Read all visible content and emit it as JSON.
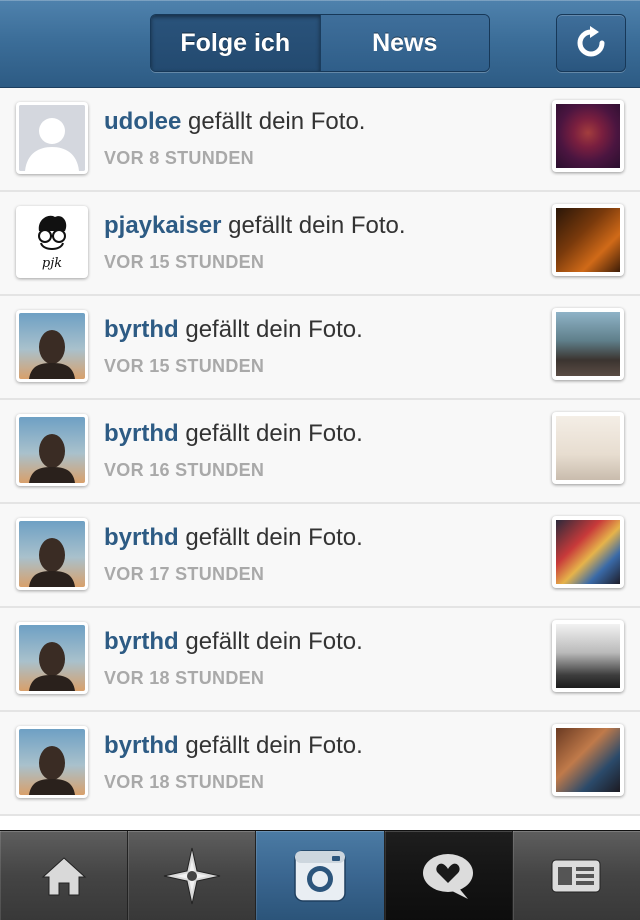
{
  "header": {
    "tabs": [
      {
        "label": "Folge ich",
        "active": true
      },
      {
        "label": "News",
        "active": false
      }
    ],
    "refresh_icon": "refresh-icon"
  },
  "news": [
    {
      "user": "udolee",
      "action": " gefällt dein Foto.",
      "time": "VOR 8 STUNDEN"
    },
    {
      "user": "pjaykaiser",
      "action": " gefällt dein Foto.",
      "time": "VOR 15 STUNDEN"
    },
    {
      "user": "byrthd",
      "action": " gefällt dein Foto.",
      "time": "VOR 15 STUNDEN"
    },
    {
      "user": "byrthd",
      "action": " gefällt dein Foto.",
      "time": "VOR 16 STUNDEN"
    },
    {
      "user": "byrthd",
      "action": " gefällt dein Foto.",
      "time": "VOR 17 STUNDEN"
    },
    {
      "user": "byrthd",
      "action": " gefällt dein Foto.",
      "time": "VOR 18 STUNDEN"
    },
    {
      "user": "byrthd",
      "action": " gefällt dein Foto.",
      "time": "VOR 18 STUNDEN"
    }
  ],
  "avatar_logo_text": "pjk",
  "tabbar": [
    "home-icon",
    "explore-icon",
    "camera-icon",
    "news-icon",
    "profile-icon"
  ],
  "colors": {
    "username": "#2d5b84",
    "header": "#3c6e99",
    "timestamp": "#a9a9a9"
  }
}
